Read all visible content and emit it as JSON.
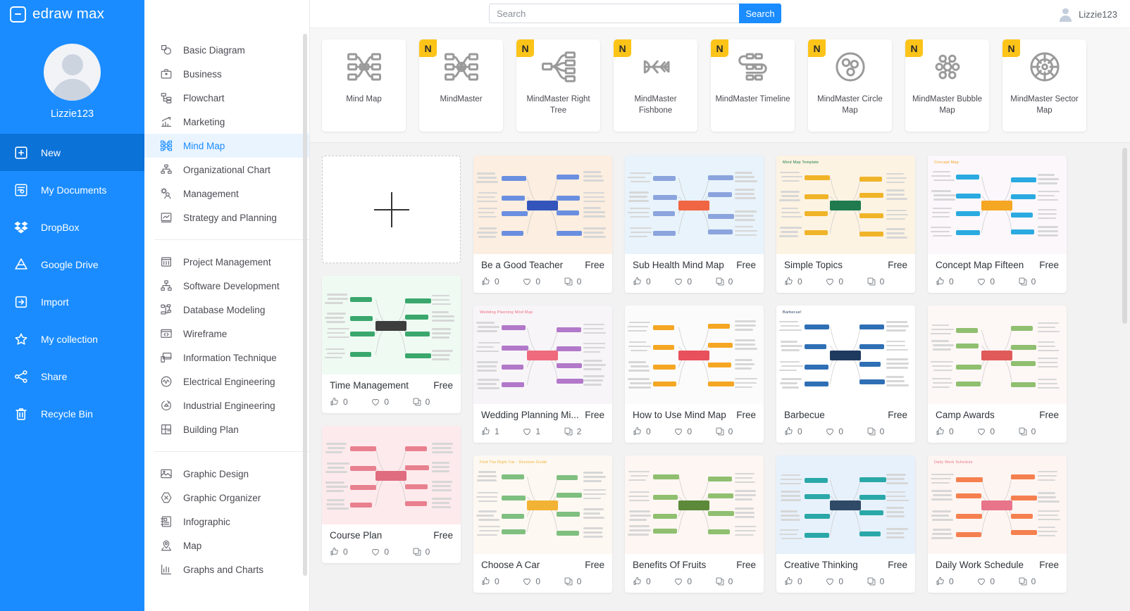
{
  "brand": {
    "name": "edraw max"
  },
  "profile": {
    "name": "Lizzie123"
  },
  "account": {
    "name": "Lizzie123"
  },
  "search": {
    "placeholder": "Search",
    "value": "",
    "button_label": "Search"
  },
  "nav": {
    "items": [
      {
        "label": "New",
        "icon": "new-document-icon",
        "active": true
      },
      {
        "label": "My Documents",
        "icon": "documents-icon",
        "active": false
      },
      {
        "label": "DropBox",
        "icon": "dropbox-icon",
        "active": false
      },
      {
        "label": "Google Drive",
        "icon": "google-drive-icon",
        "active": false
      },
      {
        "label": "Import",
        "icon": "import-icon",
        "active": false
      },
      {
        "label": "My collection",
        "icon": "star-icon",
        "active": false
      },
      {
        "label": "Share",
        "icon": "share-icon",
        "active": false
      },
      {
        "label": "Recycle Bin",
        "icon": "trash-icon",
        "active": false
      }
    ]
  },
  "categories": {
    "group1": [
      {
        "label": "Basic Diagram",
        "icon": "basic-diagram-icon",
        "active": false
      },
      {
        "label": "Business",
        "icon": "briefcase-icon",
        "active": false
      },
      {
        "label": "Flowchart",
        "icon": "flowchart-icon",
        "active": false
      },
      {
        "label": "Marketing",
        "icon": "bar-chart-icon",
        "active": false
      },
      {
        "label": "Mind Map",
        "icon": "mind-map-icon",
        "active": true
      },
      {
        "label": "Organizational Chart",
        "icon": "org-chart-icon",
        "active": false
      },
      {
        "label": "Management",
        "icon": "management-icon",
        "active": false
      },
      {
        "label": "Strategy and Planning",
        "icon": "strategy-icon",
        "active": false
      }
    ],
    "group2": [
      {
        "label": "Project Management",
        "icon": "project-management-icon",
        "active": false
      },
      {
        "label": "Software Development",
        "icon": "software-dev-icon",
        "active": false
      },
      {
        "label": "Database Modeling",
        "icon": "database-icon",
        "active": false
      },
      {
        "label": "Wireframe",
        "icon": "wireframe-icon",
        "active": false
      },
      {
        "label": "Information Technique",
        "icon": "information-technique-icon",
        "active": false
      },
      {
        "label": "Electrical Engineering",
        "icon": "electrical-icon",
        "active": false
      },
      {
        "label": "Industrial Engineering",
        "icon": "industrial-icon",
        "active": false
      },
      {
        "label": "Building Plan",
        "icon": "building-plan-icon",
        "active": false
      }
    ],
    "group3": [
      {
        "label": "Graphic Design",
        "icon": "graphic-design-icon",
        "active": false
      },
      {
        "label": "Graphic Organizer",
        "icon": "graphic-organizer-icon",
        "active": false
      },
      {
        "label": "Infographic",
        "icon": "infographic-icon",
        "active": false
      },
      {
        "label": "Map",
        "icon": "map-pin-icon",
        "active": false
      },
      {
        "label": "Graphs and Charts",
        "icon": "graphs-charts-icon",
        "active": false
      }
    ]
  },
  "types": [
    {
      "label": "Mind Map",
      "badge": "",
      "icon": "mindmap-balanced-icon"
    },
    {
      "label": "MindMaster",
      "badge": "N",
      "icon": "mindmaster-icon"
    },
    {
      "label": "MindMaster Right Tree",
      "badge": "N",
      "icon": "right-tree-icon"
    },
    {
      "label": "MindMaster Fishbone",
      "badge": "N",
      "icon": "fishbone-icon"
    },
    {
      "label": "MindMaster Timeline",
      "badge": "N",
      "icon": "timeline-icon"
    },
    {
      "label": "MindMaster Circle Map",
      "badge": "N",
      "icon": "circle-map-icon"
    },
    {
      "label": "MindMaster Bubble Map",
      "badge": "N",
      "icon": "bubble-map-icon"
    },
    {
      "label": "MindMaster Sector Map",
      "badge": "N",
      "icon": "sector-map-icon"
    }
  ],
  "new_card": {
    "label": "",
    "icon": "plus-icon"
  },
  "stat_icons": {
    "like": "thumbs-up-icon",
    "favorite": "heart-icon",
    "copy": "copy-icon"
  },
  "columns": [
    {
      "cards": [
        {
          "title": "Time Management",
          "price": "Free",
          "likes": "0",
          "favorites": "0",
          "copies": "0",
          "thumb": {
            "bg": "#effaf3",
            "accent": "#3aa76d",
            "center": "#3d3d3d",
            "heading": ""
          }
        },
        {
          "title": "Course Plan",
          "price": "Free",
          "likes": "0",
          "favorites": "0",
          "copies": "0",
          "thumb": {
            "bg": "#fdeaec",
            "accent": "#e8808f",
            "center": "#e06c7f",
            "heading": ""
          }
        }
      ]
    },
    {
      "cards": [
        {
          "title": "Be a Good Teacher",
          "price": "Free",
          "likes": "0",
          "favorites": "0",
          "copies": "0",
          "thumb": {
            "bg": "#fceee0",
            "accent": "#6b8fe0",
            "center": "#3355bb",
            "heading": ""
          }
        },
        {
          "title": "Wedding Planning Mi...",
          "price": "Free",
          "likes": "1",
          "favorites": "1",
          "copies": "2",
          "thumb": {
            "bg": "#f7f5f8",
            "accent": "#b278c9",
            "center": "#ef6a7d",
            "heading": "Wedding Planning Mind Map"
          }
        },
        {
          "title": "Choose A Car",
          "price": "Free",
          "likes": "0",
          "favorites": "0",
          "copies": "0",
          "thumb": {
            "bg": "#fdf8f2",
            "accent": "#7fbf7f",
            "center": "#f2b233",
            "heading": "Find The Right Car - Decision Guide"
          }
        }
      ]
    },
    {
      "cards": [
        {
          "title": "Sub Health Mind Map",
          "price": "Free",
          "likes": "0",
          "favorites": "0",
          "copies": "0",
          "thumb": {
            "bg": "#e8f3fb",
            "accent": "#8ba4dd",
            "center": "#f06543",
            "heading": ""
          }
        },
        {
          "title": "How to Use Mind Map",
          "price": "Free",
          "likes": "0",
          "favorites": "0",
          "copies": "0",
          "thumb": {
            "bg": "#fbfbfb",
            "accent": "#f5a623",
            "center": "#e8505b",
            "heading": ""
          }
        },
        {
          "title": "Benefits Of Fruits",
          "price": "Free",
          "likes": "0",
          "favorites": "0",
          "copies": "0",
          "thumb": {
            "bg": "#fdf6f2",
            "accent": "#8fbf6f",
            "center": "#5d8a3a",
            "heading": ""
          }
        }
      ]
    },
    {
      "cards": [
        {
          "title": "Simple Topics",
          "price": "Free",
          "likes": "0",
          "favorites": "0",
          "copies": "0",
          "thumb": {
            "bg": "#fdf3e3",
            "accent": "#f0b429",
            "center": "#1f7a4d",
            "heading": "Mind Map Template"
          }
        },
        {
          "title": "Barbecue",
          "price": "Free",
          "likes": "0",
          "favorites": "0",
          "copies": "0",
          "thumb": {
            "bg": "#ffffff",
            "accent": "#2f6fb5",
            "center": "#1f3a5f",
            "heading": "Barbecue!"
          }
        },
        {
          "title": "Creative Thinking",
          "price": "Free",
          "likes": "0",
          "favorites": "0",
          "copies": "0",
          "thumb": {
            "bg": "#e7f1fb",
            "accent": "#2aa8a8",
            "center": "#2f4a66",
            "heading": ""
          }
        }
      ]
    },
    {
      "cards": [
        {
          "title": "Concept Map Fifteen",
          "price": "Free",
          "likes": "0",
          "favorites": "0",
          "copies": "0",
          "thumb": {
            "bg": "#fbf7fb",
            "accent": "#2aaae0",
            "center": "#f5a623",
            "heading": "Concept Map"
          }
        },
        {
          "title": "Camp Awards",
          "price": "Free",
          "likes": "0",
          "favorites": "0",
          "copies": "0",
          "thumb": {
            "bg": "#fdf7f6",
            "accent": "#8fbf6f",
            "center": "#e05a5a",
            "heading": ""
          }
        },
        {
          "title": "Daily Work Schedule",
          "price": "Free",
          "likes": "0",
          "favorites": "0",
          "copies": "0",
          "thumb": {
            "bg": "#fdf5f2",
            "accent": "#f5804f",
            "center": "#e8748a",
            "heading": "Daily Work Schedule"
          }
        }
      ]
    }
  ],
  "colors": {
    "brand_blue": "#1a8cff",
    "active_nav": "#0b72d8",
    "badge_yellow": "#fcc419",
    "page_bg": "#f2f2f3"
  }
}
